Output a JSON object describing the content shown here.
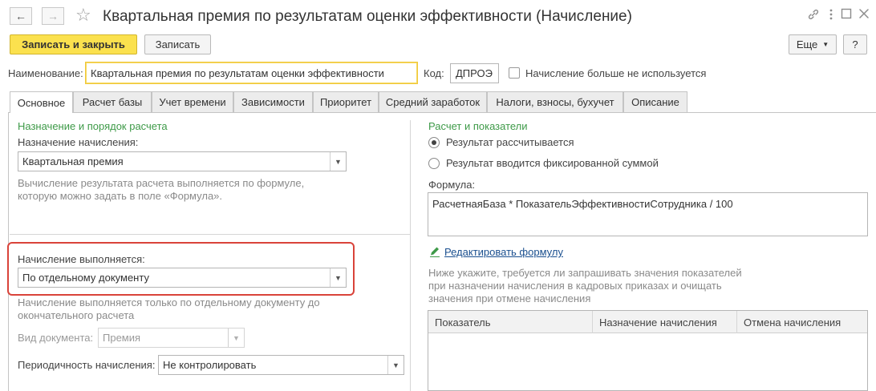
{
  "window": {
    "title": "Квартальная премия по результатам оценки эффективности (Начисление)",
    "nav_back_icon": "arrow-left-icon",
    "nav_forward_icon": "arrow-right-icon",
    "favorite_icon": "star-icon",
    "link_icon": "link-icon",
    "menu_icon": "more-vertical-icon",
    "maximize_icon": "maximize-icon",
    "close_icon": "close-icon"
  },
  "toolbar": {
    "save_close_label": "Записать и закрыть",
    "save_label": "Записать",
    "more_label": "Еще",
    "help_label": "?"
  },
  "header_fields": {
    "name_label": "Наименование:",
    "name_value": "Квартальная премия по результатам оценки эффективности",
    "code_label": "Код:",
    "code_value": "ДПРОЭ",
    "unused_label": "Начисление больше не используется"
  },
  "tabs": [
    {
      "label": "Основное"
    },
    {
      "label": "Расчет базы"
    },
    {
      "label": "Учет времени"
    },
    {
      "label": "Зависимости"
    },
    {
      "label": "Приоритет"
    },
    {
      "label": "Средний заработок"
    },
    {
      "label": "Налоги, взносы, бухучет"
    },
    {
      "label": "Описание"
    }
  ],
  "left": {
    "group_title": "Назначение и порядок расчета",
    "purpose_label": "Назначение начисления:",
    "purpose_value": "Квартальная премия",
    "purpose_hint_1": "Вычисление результата расчета выполняется по формуле,",
    "purpose_hint_2": "которую можно задать в поле «Формула».",
    "exec_label": "Начисление выполняется:",
    "exec_value": "По отдельному документу",
    "exec_hint_1": "Начисление выполняется только по отдельному документу до",
    "exec_hint_2": "окончательного расчета",
    "doc_type_label": "Вид документа:",
    "doc_type_value": "Премия",
    "periodicity_label": "Периодичность начисления:",
    "periodicity_value": "Не контролировать"
  },
  "right": {
    "group_title": "Расчет и показатели",
    "radio_calc_label": "Результат рассчитывается",
    "radio_fixed_label": "Результат вводится фиксированной суммой",
    "formula_label": "Формулa:",
    "formula_value": "РасчетнаяБаза * ПоказательЭффективностиСотрудника / 100",
    "edit_formula_icon": "pencil-icon",
    "edit_formula_link": "Редактировать формулу",
    "indicators_hint_1": "Ниже укажите, требуется ли запрашивать значения показателей",
    "indicators_hint_2": "при назначении начисления в кадровых приказах и очищать",
    "indicators_hint_3": "значения при отмене начисления",
    "table_headers": [
      "Показатель",
      "Назначение начисления",
      "Отмена начисления"
    ]
  },
  "colors": {
    "primary_button": "#fbe14e",
    "group_title": "#3e9a48",
    "highlight_frame": "#d9433a",
    "link": "#1a4f8f"
  }
}
